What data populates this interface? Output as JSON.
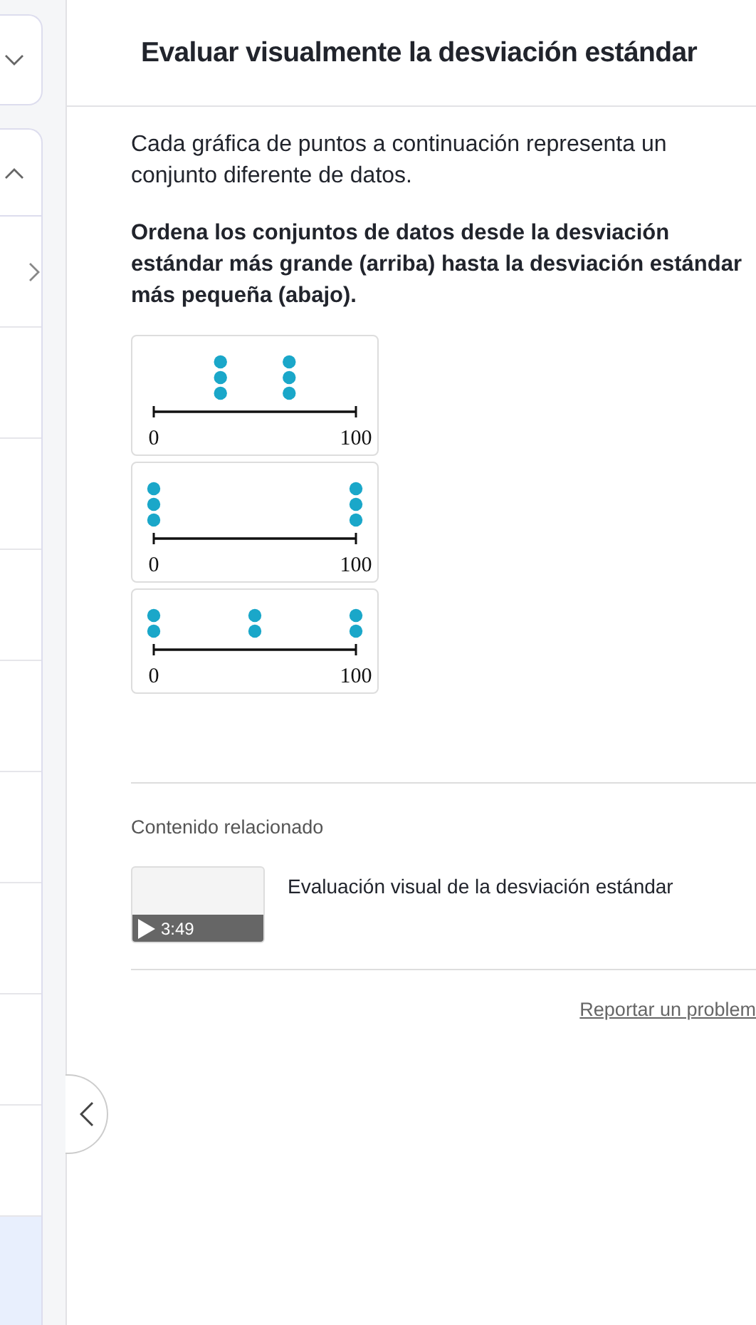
{
  "sidebar": {
    "sections": [
      {
        "expanded": false
      },
      {
        "expanded": true
      }
    ],
    "items": [
      {
        "kind": "arrow",
        "selected": false
      },
      {
        "kind": "plain",
        "selected": false
      },
      {
        "kind": "plain",
        "selected": false
      },
      {
        "kind": "plain",
        "selected": false
      },
      {
        "kind": "plain",
        "selected": false
      },
      {
        "kind": "plain",
        "selected": false
      },
      {
        "kind": "plain",
        "selected": false
      },
      {
        "kind": "plain",
        "selected": false
      },
      {
        "kind": "plain",
        "selected": false
      },
      {
        "kind": "plain",
        "selected": true
      }
    ]
  },
  "title": "Evaluar visualmente la desviación estándar",
  "intro": "Cada gráfica de puntos a continuación representa un conjunto diferente de datos.",
  "instruction": "Ordena los conjuntos de datos desde la desviación estándar más grande (arriba) hasta la desviación estándar más pequeña (abajo).",
  "plots": [
    {
      "kind": "inner",
      "axis_labels": [
        "0",
        "100"
      ]
    },
    {
      "kind": "ends",
      "axis_labels": [
        "0",
        "100"
      ]
    },
    {
      "kind": "spread",
      "axis_labels": [
        "0",
        "100"
      ]
    }
  ],
  "related": {
    "heading": "Contenido relacionado",
    "items": [
      {
        "duration": "3:49",
        "title": "Evaluación visual de la desviación estándar"
      }
    ]
  },
  "report_link": "Reportar un problem"
}
